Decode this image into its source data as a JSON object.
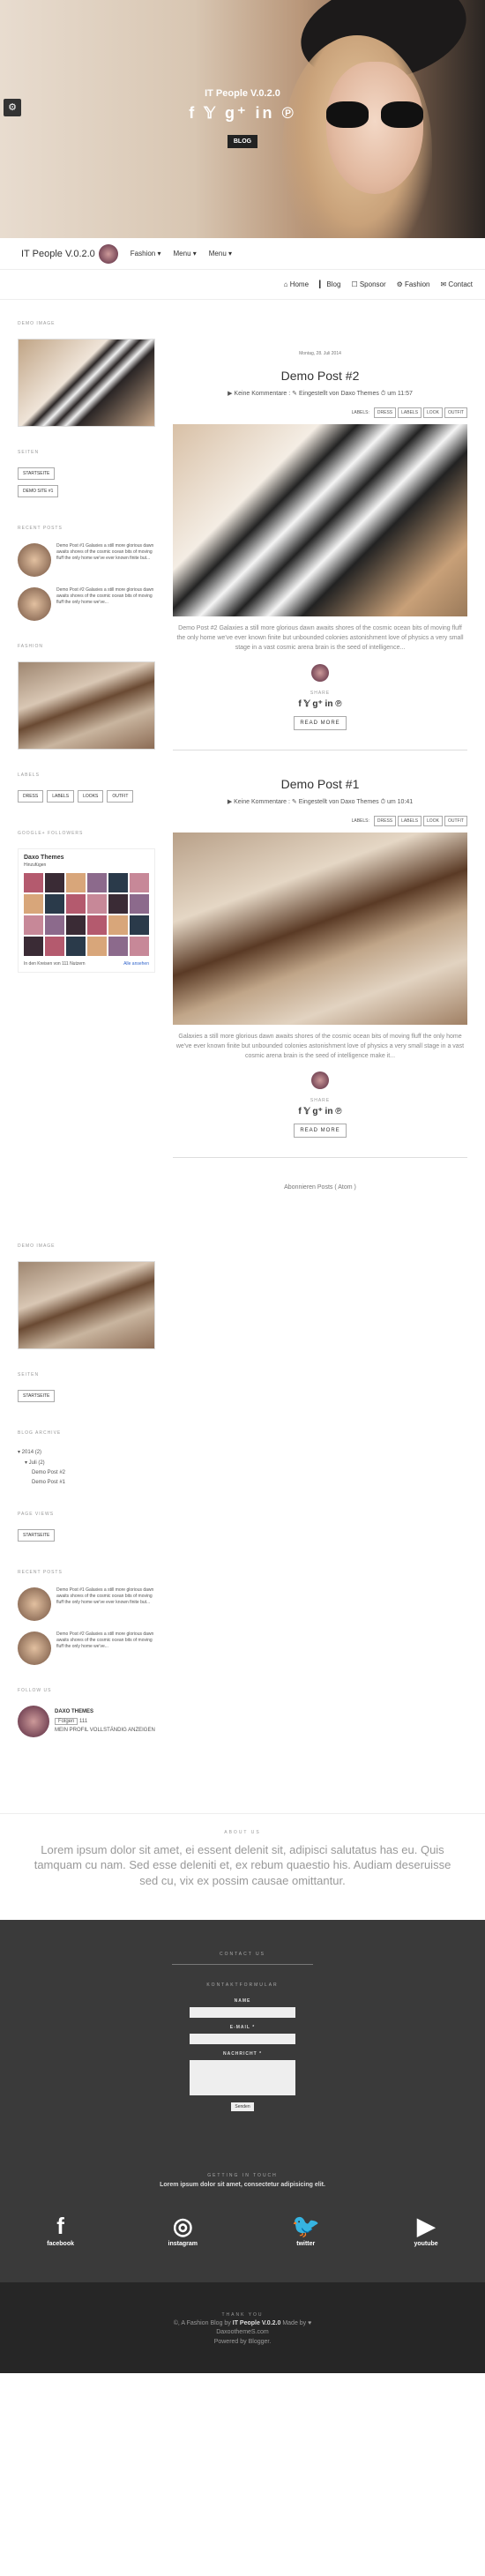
{
  "hero": {
    "title": "IT People V.0.2.0",
    "social_icons": "f 𝕐 g⁺ in ℗",
    "blog_button": "BLOG",
    "menu_icon": "gear-icon"
  },
  "topbar": {
    "site_title": "IT People V.0.2.0",
    "nav": [
      "Fashion ▾",
      "Menu ▾",
      "Menu ▾"
    ]
  },
  "secondnav": [
    "⌂ Home",
    "▎ Blog",
    "☐ Sponsor",
    "⚙ Fashion",
    "✉ Contact"
  ],
  "sidebar1": {
    "widget_image1_title": "DEMO IMAGE",
    "archive_title": "SEITEN",
    "pages": [
      "STARTSEITE",
      "DEMO SITE #1"
    ],
    "recent_title": "RECENT POSTS",
    "recent": [
      "Demo Post #1 Galaxies a still more glorious dawn awaits shores of the cosmic ocean bits of moving fluff the only home we've ever known finite but...",
      "Demo Post #2 Galaxies a still more glorious dawn awaits shores of the cosmic ocean bits of moving fluff the only home we've..."
    ],
    "image2_title": "FASHION",
    "labels_title": "LABELS",
    "labels": [
      "DRESS",
      "LABELS",
      "LOOKS",
      "OUTFIT"
    ],
    "follow_title": "GOOGLE+ FOLLOWERS",
    "follow_name": "Daxo Themes",
    "follow_button": "Hinzufügen",
    "follow_footer": "In den Kreisen von 111 Nutzern",
    "follow_link": "Alle ansehen"
  },
  "posts": [
    {
      "date": "Montag, 28. Juli 2014",
      "title": "Demo Post #2",
      "meta": "▶ Keine Kommentare : ✎ Eingestellt von Daxo Themes ⏱ um 11:57",
      "labels": [
        "LABELS:",
        "DRESS",
        "LABELS",
        "LOOK",
        "OUTFIT"
      ],
      "excerpt": "Demo Post #2 Galaxies a still more glorious dawn awaits shores of the cosmic ocean bits of moving fluff the only home we've ever known finite but unbounded colonies astonishment love of physics a very small stage in a vast cosmic arena brain is the seed of intelligence...",
      "share": "SHARE",
      "share_icons": "f 𝕐 g⁺ in ℗",
      "read_more": "READ MORE"
    },
    {
      "date": "",
      "title": "Demo Post #1",
      "meta": "▶ Keine Kommentare : ✎ Eingestellt von Daxo Themes ⏱ um 10:41",
      "labels": [
        "LABELS:",
        "DRESS",
        "LABELS",
        "LOOK",
        "OUTFIT"
      ],
      "excerpt": "Galaxies a still more glorious dawn awaits shores of the cosmic ocean bits of moving fluff the only home we've ever known finite but unbounded colonies astonishment love of physics a very small stage in a vast cosmic arena brain is the seed of intelligence make it...",
      "share": "SHARE",
      "share_icons": "f 𝕐 g⁺ in ℗",
      "read_more": "READ MORE"
    }
  ],
  "atom_text": "Abonnieren Posts ( Atom )",
  "sidebar2": {
    "image_title": "DEMO IMAGE",
    "pages_title": "SEITEN",
    "pages": [
      "STARTSEITE"
    ],
    "archive_title": "BLOG ARCHIVE",
    "archive": [
      "▾ 2014 (2)",
      "▾ Juli (2)",
      "Demo Post #2",
      "Demo Post #1"
    ],
    "pages2_title": "PAGE VIEWS",
    "pages2": [
      "STARTSEITE"
    ],
    "recent_title": "RECENT POSTS",
    "recent": [
      "Demo Post #1 Galaxies a still more glorious dawn awaits shores of the cosmic ocean bits of moving fluff the only home we've ever known finite but...",
      "Demo Post #2 Galaxies a still more glorious dawn awaits shores of the cosmic ocean bits of moving fluff the only home we've..."
    ],
    "g_title": "FOLLOW US",
    "g_name": "DAXO THEMES",
    "g_follow": "Folgen",
    "g_count": "111",
    "g_footer": "MEIN PROFIL VOLLSTÄNDIG ANZEIGEN"
  },
  "about": {
    "heading": "ABOUT US",
    "text": "Lorem ipsum dolor sit amet, ei essent delenit sit, adipisci salutatus has eu. Quis tamquam cu nam. Sed esse deleniti et, ex rebum quaestio his. Audiam deseruisse sed cu, vix ex possim causae omittantur."
  },
  "contact": {
    "heading": "CONTACT US",
    "form_title": "KONTAKTFORMULAR",
    "name_label": "NAME",
    "email_label": "E-MAIL *",
    "msg_label": "NACHRICHT *",
    "submit": "Senden",
    "touch_heading": "GETTING IN TOUCH",
    "touch_text": "Lorem ipsum dolor sit amet, consectetur adipisicing elit.",
    "socials": [
      {
        "icon": "f",
        "label": "facebook"
      },
      {
        "icon": "◎",
        "label": "instagram"
      },
      {
        "icon": "🐦",
        "label": "twitter"
      },
      {
        "icon": "▶",
        "label": "youtube"
      }
    ]
  },
  "footer": {
    "heading": "THANK YOU",
    "line1_prefix": "©, A Fashion Blog by",
    "line1_brand": "IT People V.0.2.0",
    "line1_suffix": "Made by ♥",
    "line2": "DaxoothemeS.com",
    "line3": "Powered by Blogger."
  }
}
